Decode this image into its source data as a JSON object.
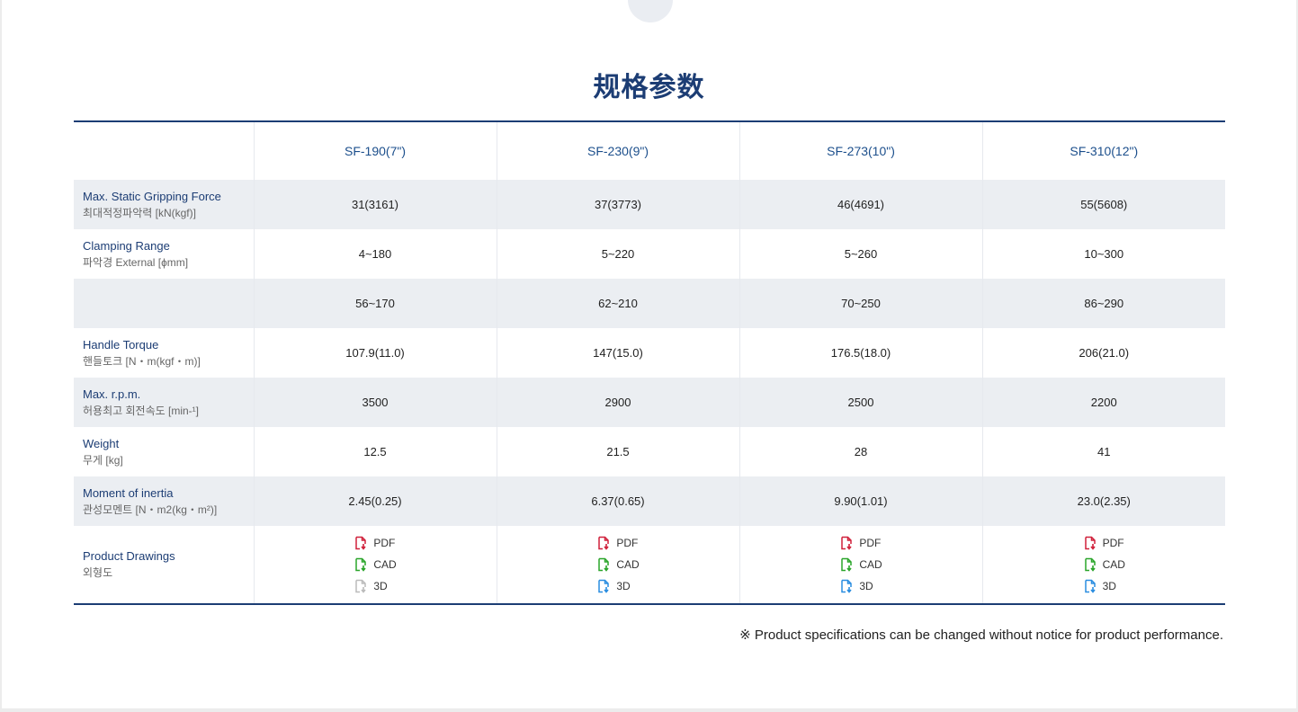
{
  "title": "规格参数",
  "columns": [
    "SF-190(7\")",
    "SF-230(9\")",
    "SF-273(10\")",
    "SF-310(12\")"
  ],
  "rows": [
    {
      "en": "Max. Static Gripping Force",
      "ko": "최대적정파악력 [kN(kgf)]",
      "values": [
        "31(3161)",
        "37(3773)",
        "46(4691)",
        "55(5608)"
      ]
    },
    {
      "en": "Clamping Range",
      "ko": "파악경 External [ɸmm]",
      "values": [
        "4~180",
        "5~220",
        "5~260",
        "10~300"
      ]
    },
    {
      "en": "",
      "ko": "",
      "values": [
        "56~170",
        "62~210",
        "70~250",
        "86~290"
      ]
    },
    {
      "en": "Handle Torque",
      "ko": "핸들토크 [N・m(kgf・m)]",
      "values": [
        "107.9(11.0)",
        "147(15.0)",
        "176.5(18.0)",
        "206(21.0)"
      ]
    },
    {
      "en": "Max. r.p.m.",
      "ko": "허용최고 회전속도 [min-¹]",
      "values": [
        "3500",
        "2900",
        "2500",
        "2200"
      ]
    },
    {
      "en": "Weight",
      "ko": "무게 [kg]",
      "values": [
        "12.5",
        "21.5",
        "28",
        "41"
      ]
    },
    {
      "en": "Moment of inertia",
      "ko": "관성모멘트 [N・m2(kg・m²)]",
      "values": [
        "2.45(0.25)",
        "6.37(0.65)",
        "9.90(1.01)",
        "23.0(2.35)"
      ]
    }
  ],
  "drawings": {
    "en": "Product Drawings",
    "ko": "외형도",
    "labels": {
      "pdf": "PDF",
      "cad": "CAD",
      "threed": "3D"
    },
    "colors": {
      "pdf": "#d0213b",
      "cad": "#2aa52a",
      "threed": "#2a8de0",
      "disabled": "#bbbbbb"
    },
    "threed_available": [
      false,
      true,
      true,
      true
    ]
  },
  "note": "※ Product specifications can be changed without notice for product performance."
}
